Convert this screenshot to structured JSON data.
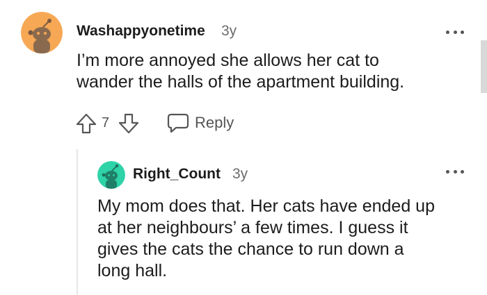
{
  "comments": [
    {
      "username": "Washappyonetime",
      "age": "3y",
      "text_lines": [
        "I’m more annoyed she allows her cat to",
        "wander the halls of the apartment building."
      ],
      "vote_count": "7",
      "reply_label": "Reply",
      "avatar_color": "#f7a855"
    },
    {
      "username": "Right_Count",
      "age": "3y",
      "text_lines": [
        "My mom does that. Her cats have ended up",
        "at her neighbours’ a few times. I guess it",
        "gives the cats the chance to run down a",
        "long hall."
      ],
      "avatar_color": "#2ed3a8"
    }
  ]
}
